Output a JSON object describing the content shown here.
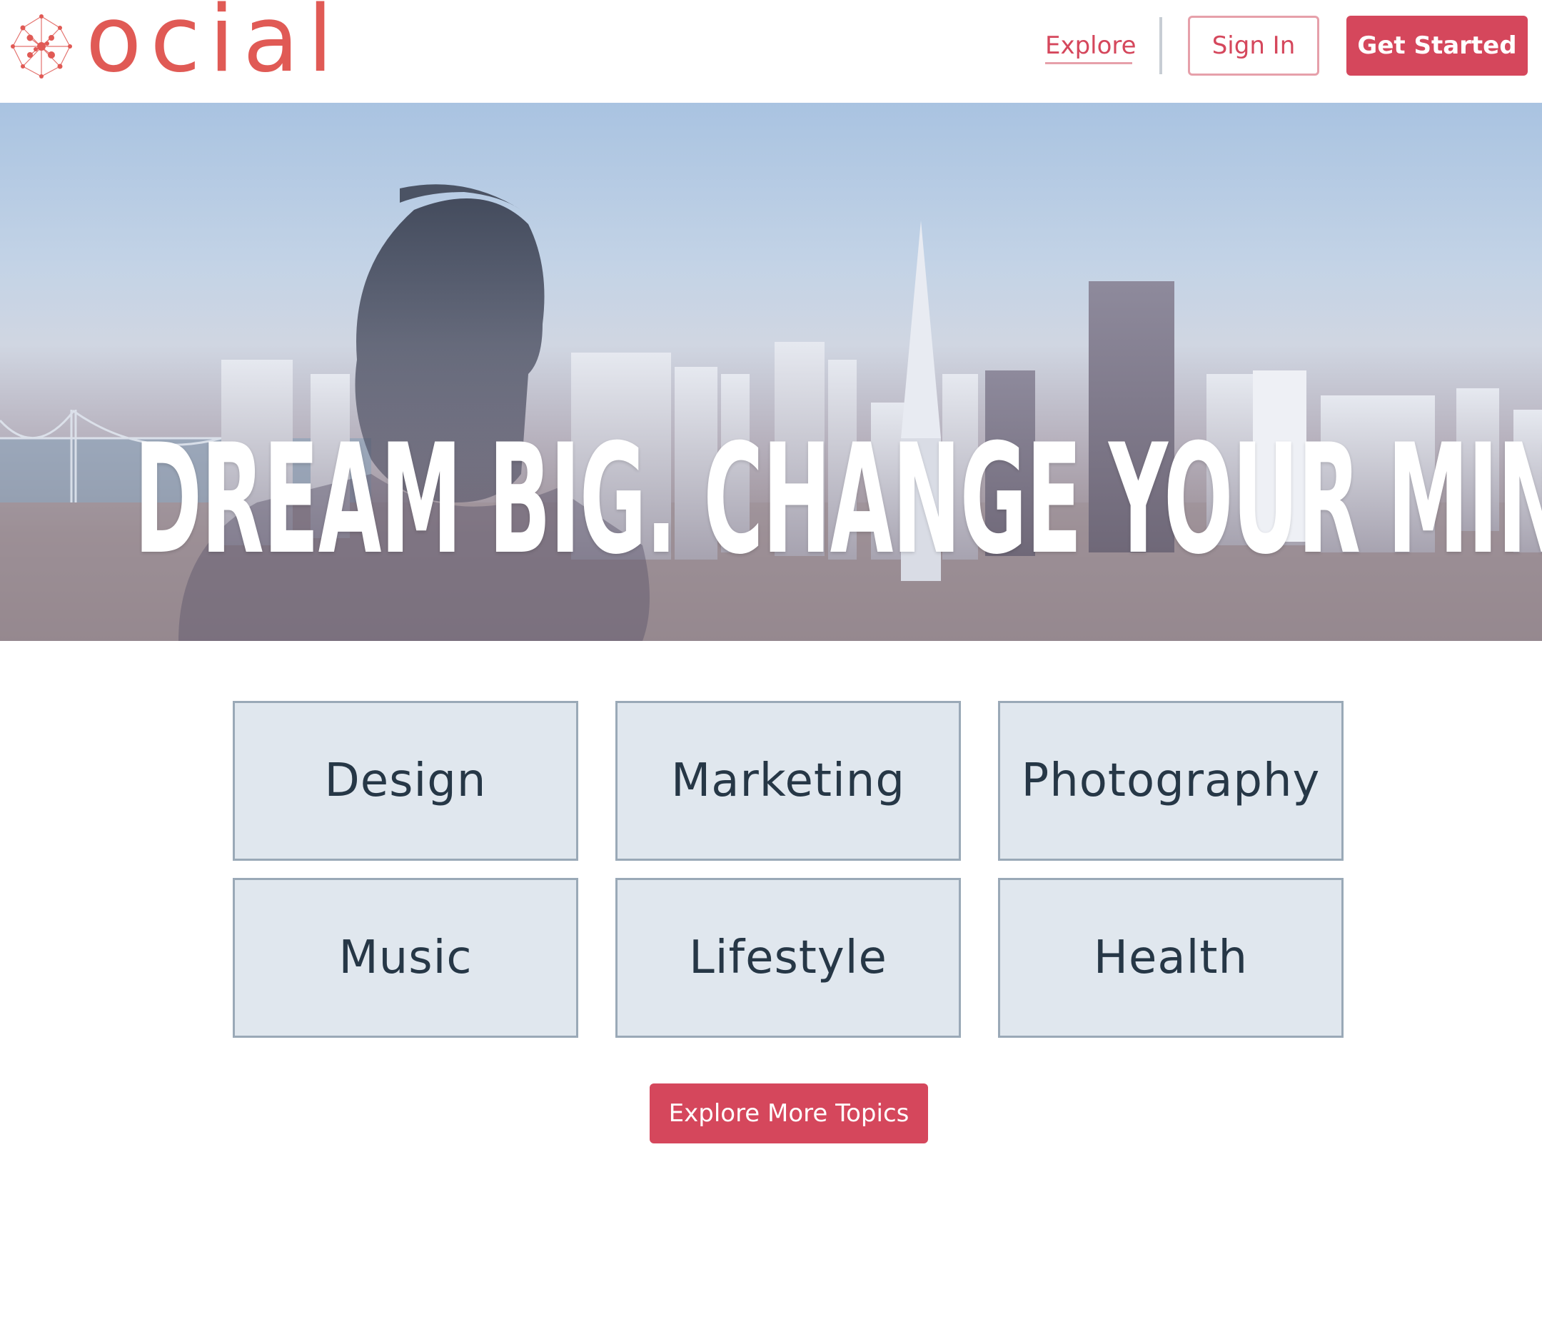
{
  "brand": {
    "logo_text": "ocial",
    "accent_color": "#d5475c",
    "logo_color": "#e05a55"
  },
  "nav": {
    "explore_label": "Explore",
    "signin_label": "Sign In",
    "get_started_label": "Get Started"
  },
  "hero": {
    "headline": "DREAM BIG. CHANGE YOUR MINDSET.",
    "image": "city-skyline-with-person-photo"
  },
  "topics": [
    {
      "label": "Design"
    },
    {
      "label": "Marketing"
    },
    {
      "label": "Photography"
    },
    {
      "label": "Music"
    },
    {
      "label": "Lifestyle"
    },
    {
      "label": "Health"
    }
  ],
  "cta": {
    "explore_more_label": "Explore More Topics"
  }
}
